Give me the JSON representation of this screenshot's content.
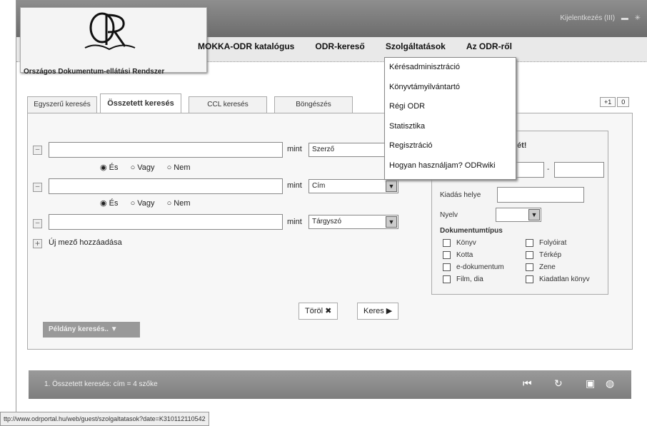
{
  "header": {
    "logo_subtitle": "Országos Dokumentum-ellátási Rendszer",
    "logout_text": "Kijelentkezés (III)",
    "nav": [
      "MOKKA-ODR katalógus",
      "ODR-kereső",
      "Szolgáltatások",
      "Az ODR-ről"
    ]
  },
  "dropdown": {
    "items": [
      "Kérésadminisztráció",
      "Könyvtámyilvántartó",
      "Régi ODR",
      "Statisztika",
      "Regisztráció",
      "Hogyan használjam? ODRwiki"
    ]
  },
  "tabs": [
    "Egyszerű keresés",
    "Összetett keresés",
    "CCL keresés",
    "Böngészés"
  ],
  "pager": [
    "+1",
    "0"
  ],
  "search_rows": [
    {
      "value": "",
      "mint": "mint",
      "field": "Szerző"
    },
    {
      "value": "",
      "mint": "mint",
      "field": "Cím"
    },
    {
      "value": "",
      "mint": "mint",
      "field": "Tárgyszó"
    }
  ],
  "operators": [
    "És",
    "Vagy",
    "Nem"
  ],
  "add_field": "Új mező hozzáadása",
  "right_box": {
    "heading_fragment": "ét!",
    "kiadas_helye": "Kiadás helye",
    "nyelv": "Nyelv",
    "doc_type_title": "Dokumentumtípus",
    "doc_types": [
      "Könyv",
      "Folyóirat",
      "Kotta",
      "Térkép",
      "e-dokumentum",
      "Zene",
      "Film, dia",
      "Kiadatlan könyv"
    ]
  },
  "buttons": {
    "clear": "Töröl ✖",
    "search": "Keres ▶",
    "peldany": "Példány keresés.. ▼"
  },
  "results": {
    "line": "1.     Összetett keresés: cím = 4 szőke"
  },
  "status_url": "ttp://www.odrportal.hu/web/guest/szolgaltatasok?date=K310112110542"
}
